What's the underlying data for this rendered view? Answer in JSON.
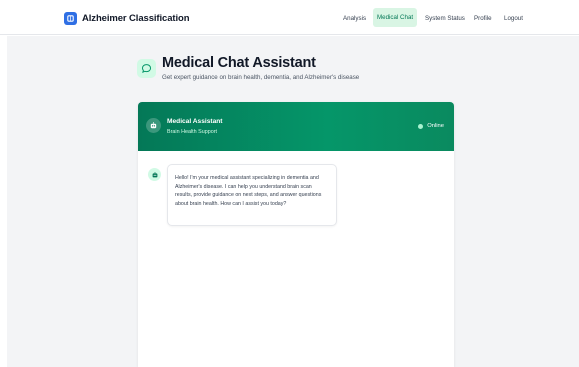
{
  "navbar": {
    "brand": "Alzheimer Classification",
    "links": [
      "Analysis",
      "Medical Chat",
      "System Status",
      "Profile",
      "Logout"
    ],
    "active_index": 1
  },
  "header": {
    "title": "Medical Chat Assistant",
    "subtitle": "Get expert guidance on brain health, dementia, and Alzheimer's disease"
  },
  "chat": {
    "assistant_name": "Medical Assistant",
    "assistant_role": "Brain Health Support",
    "status": "Online",
    "messages": [
      {
        "sender": "assistant",
        "text": "Hello! I'm your medical assistant specializing in dementia and Alzheimer's disease. I can help you understand brain scan results, provide guidance on next steps, and answer questions about brain health. How can I assist you today?"
      }
    ]
  },
  "colors": {
    "brand_blue": "#2f6fe4",
    "accent_green": "#047857",
    "active_nav_bg": "#d9f5e4",
    "page_bg": "#f3f4f6"
  },
  "icons": {
    "brand": "brain-app-icon",
    "header": "chat-bubble-icon",
    "assistant": "robot-icon",
    "status": "status-dot"
  }
}
